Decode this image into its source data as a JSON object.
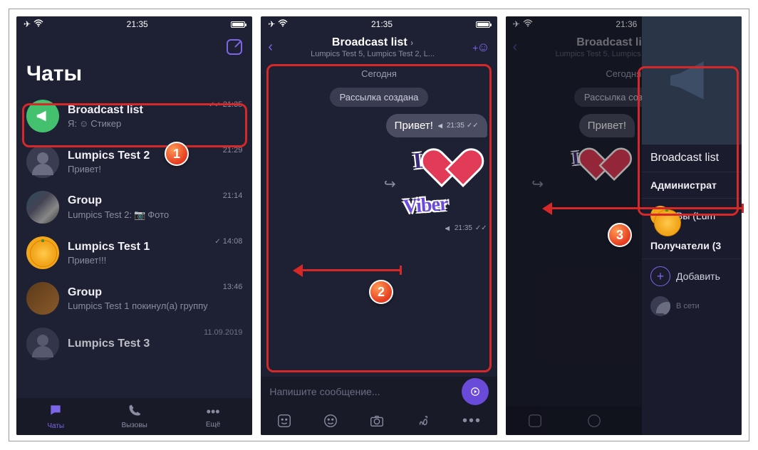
{
  "status": {
    "time1": "21:35",
    "time2": "21:35",
    "time3": "21:36"
  },
  "screen1": {
    "title": "Чаты",
    "compose_name": "compose",
    "chats": [
      {
        "name": "Broadcast list",
        "preview_prefix": "Я:",
        "preview": "Стикер",
        "time": "21:35",
        "read": true,
        "avatar": "broadcast"
      },
      {
        "name": "Lumpics Test 2",
        "preview": "Привет!",
        "time": "21:29",
        "avatar": "blank"
      },
      {
        "name": "Group",
        "preview_prefix": "Lumpics Test 2:",
        "preview": "Фото",
        "time": "21:14",
        "avatar": "group1"
      },
      {
        "name": "Lumpics Test 1",
        "preview": "Привет!!!",
        "time": "14:08",
        "read": true,
        "avatar": "lemon"
      },
      {
        "name": "Group",
        "preview": "Lumpics Test 1 покинул(а) группу",
        "time": "13:46",
        "avatar": "group2"
      },
      {
        "name": "Lumpics Test 3",
        "preview": "",
        "time": "11.09.2019",
        "avatar": "blank"
      }
    ],
    "tabs": {
      "chats": "Чаты",
      "calls": "Вызовы",
      "more": "Ещё"
    }
  },
  "screen2": {
    "header_title": "Broadcast list",
    "header_sub": "Lumpics Test 5, Lumpics Test 2, L...",
    "day_label": "Сегодня",
    "system_pill": "Рассылка создана",
    "msg1": "Привет!",
    "msg1_time": "21:35",
    "sticker_time": "21:35",
    "composer_placeholder": "Напишите сообщение..."
  },
  "screen3": {
    "panel_title": "Broadcast list",
    "admins_label": "Администрат",
    "you_label": "Вы (Lum",
    "recipients_label": "Получатели (3",
    "add_label": "Добавить",
    "online_label": "В сети"
  },
  "steps": {
    "s1": "1",
    "s2": "2",
    "s3": "3"
  }
}
